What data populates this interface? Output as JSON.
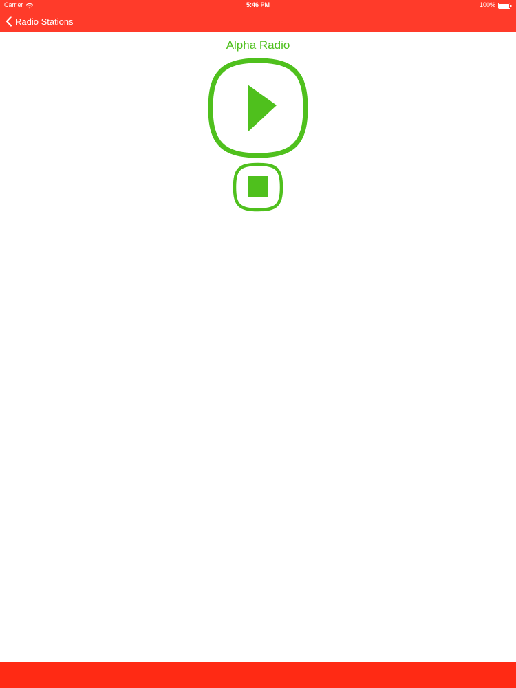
{
  "status_bar": {
    "carrier": "Carrier",
    "time": "5:46 PM",
    "battery": "100%"
  },
  "nav": {
    "back_label": "Radio Stations"
  },
  "station": {
    "name": "Alpha Radio"
  },
  "colors": {
    "bar_red": "#ff3b2a",
    "bottom_red": "#ff2a14",
    "accent_green": "#4fc01d"
  },
  "icons": {
    "back": "chevron-left-icon",
    "play": "play-icon",
    "stop": "stop-icon",
    "wifi": "wifi-icon",
    "battery": "battery-icon"
  }
}
